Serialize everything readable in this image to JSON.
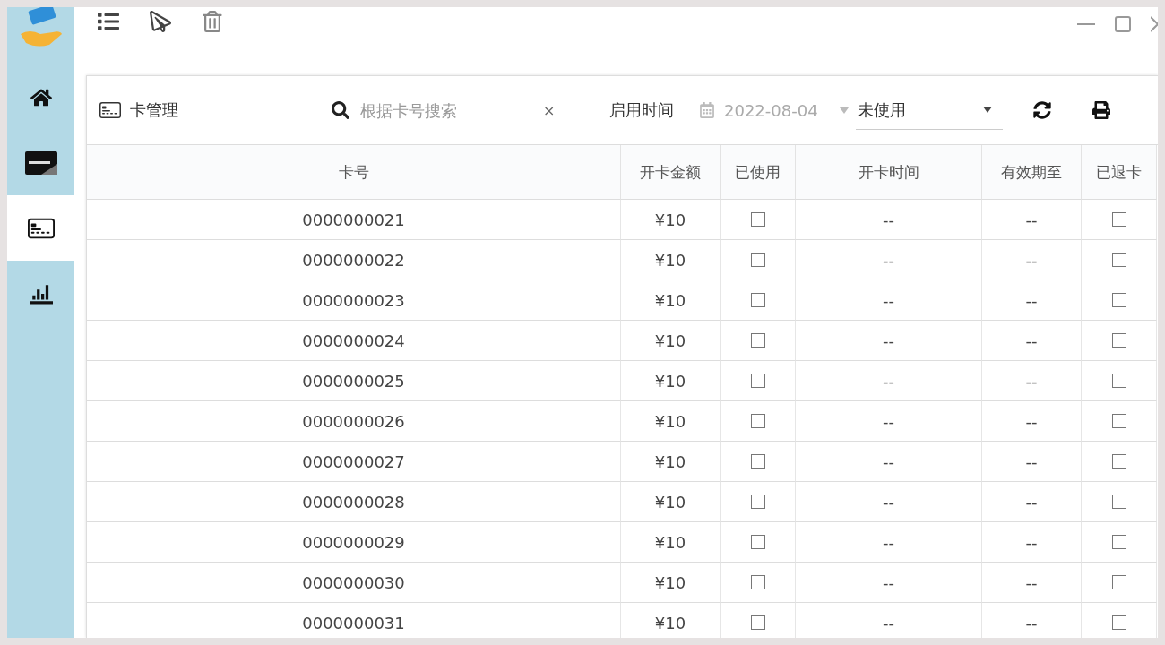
{
  "sidebar": {
    "items": [
      {
        "kind": "home",
        "selected": false
      },
      {
        "kind": "discover",
        "selected": false
      },
      {
        "kind": "card",
        "selected": true
      },
      {
        "kind": "chart",
        "selected": false
      }
    ]
  },
  "toolbar": {
    "items": [
      {
        "kind": "list"
      },
      {
        "kind": "send"
      },
      {
        "kind": "trash"
      }
    ]
  },
  "panel": {
    "title": "卡管理",
    "search": {
      "placeholder": "根据卡号搜索",
      "clear": "×"
    },
    "date_label": "启用时间",
    "date": "2022-08-04",
    "status": "未使用"
  },
  "table": {
    "columns": [
      {
        "label": "卡号",
        "kind": "text"
      },
      {
        "label": "开卡金额",
        "kind": "text"
      },
      {
        "label": "已使用",
        "kind": "check"
      },
      {
        "label": "开卡时间",
        "kind": "text"
      },
      {
        "label": "有效期至",
        "kind": "text"
      },
      {
        "label": "已退卡",
        "kind": "check"
      }
    ],
    "rows": [
      {
        "cells": [
          "0000000021",
          "¥10",
          false,
          "--",
          "--",
          false
        ]
      },
      {
        "cells": [
          "0000000022",
          "¥10",
          false,
          "--",
          "--",
          false
        ]
      },
      {
        "cells": [
          "0000000023",
          "¥10",
          false,
          "--",
          "--",
          false
        ]
      },
      {
        "cells": [
          "0000000024",
          "¥10",
          false,
          "--",
          "--",
          false
        ]
      },
      {
        "cells": [
          "0000000025",
          "¥10",
          false,
          "--",
          "--",
          false
        ]
      },
      {
        "cells": [
          "0000000026",
          "¥10",
          false,
          "--",
          "--",
          false
        ]
      },
      {
        "cells": [
          "0000000027",
          "¥10",
          false,
          "--",
          "--",
          false
        ]
      },
      {
        "cells": [
          "0000000028",
          "¥10",
          false,
          "--",
          "--",
          false
        ]
      },
      {
        "cells": [
          "0000000029",
          "¥10",
          false,
          "--",
          "--",
          false
        ]
      },
      {
        "cells": [
          "0000000030",
          "¥10",
          false,
          "--",
          "--",
          false
        ]
      },
      {
        "cells": [
          "0000000031",
          "¥10",
          false,
          "--",
          "--",
          false
        ]
      }
    ]
  }
}
